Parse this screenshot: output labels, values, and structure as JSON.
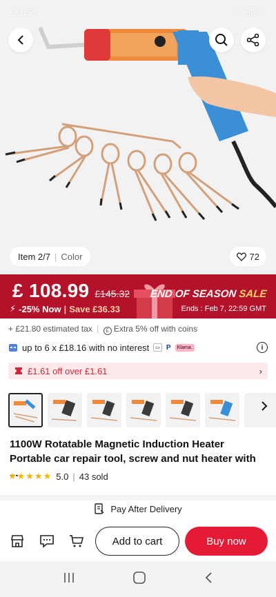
{
  "status_bar": {
    "time": "23:57",
    "battery": "58%"
  },
  "gallery": {
    "item_label": "Item 2/7",
    "color_label": "Color",
    "likes": "72"
  },
  "price": {
    "current": "£ 108.99",
    "original": "£145.32",
    "discount": "-25% Now",
    "save": "Save £36.33",
    "promo_title": "END OF SEASON",
    "promo_sale": "SALE",
    "ends": "Ends : Feb 7, 22:59 GMT"
  },
  "tax_line": "+ £21.80 estimated tax",
  "coins_line": "Extra 5% off with coins",
  "installment": "up to 6 x £18.16 with no interest",
  "coupon": "£1.61 off over £1.61",
  "title": "1100W Rotatable Magnetic Induction Heater Portable car repair tool, screw and nut heater with ...",
  "rating": {
    "score": "5.0",
    "sold": "43 sold"
  },
  "pay_after_delivery": "Pay After Delivery",
  "buttons": {
    "add_to_cart": "Add to cart",
    "buy_now": "Buy now"
  },
  "colors": {
    "banner": "#b3122a",
    "buy": "#e51a35",
    "star": "#f6b400",
    "tool_blue": "#3b8fd6",
    "tool_orange": "#f08a3a"
  },
  "icons": [
    "back-icon",
    "search-icon",
    "share-icon",
    "heart-icon",
    "store-icon",
    "chat-icon",
    "cart-icon",
    "recents-icon",
    "home-icon",
    "nav-back-icon",
    "info-icon",
    "coupon-icon",
    "delivery-icon",
    "chevron-right-icon"
  ]
}
